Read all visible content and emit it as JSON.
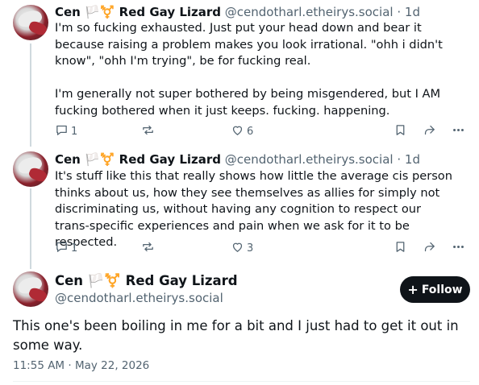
{
  "posts": [
    {
      "author_name": "Cen 🏳️⚧️ Red Gay Lizard",
      "handle": "@cendotharl.etheirys.social",
      "time": "· 1d",
      "paragraphs": [
        "I'm so fucking exhausted. Just put your head down and bear it because raising a problem makes you look irrational. \"ohh i didn't know\", \"ohh I'm trying\", be for fucking real.",
        "I'm generally not super bothered by being misgendered, but I AM fucking bothered when it just keeps. fucking. happening."
      ],
      "reply_count": "1",
      "favorite_count": "6"
    },
    {
      "author_name": "Cen 🏳️⚧️ Red Gay Lizard",
      "handle": "@cendotharl.etheirys.social",
      "time": "· 1d",
      "paragraphs": [
        "It's stuff like this that really shows how little the average cis person thinks about us, how they see themselves as allies for simply not discriminating us, without having any cognition to respect our trans-specific experiences and pain when we ask for it to be respected."
      ],
      "reply_count": "1",
      "favorite_count": "3"
    }
  ],
  "main_post": {
    "author_name": "Cen 🏳️⚧️ Red Gay Lizard",
    "handle": "@cendotharl.etheirys.social",
    "follow_label": "Follow",
    "text": "This one's been boiling in me for a bit and I just had to get it out in some way.",
    "timestamp": "11:55 AM · May 22, 2026"
  },
  "icons": [
    "reply-icon",
    "boost-icon",
    "favorite-icon",
    "bookmark-icon",
    "share-icon",
    "more-icon",
    "plus-icon"
  ],
  "colors": {
    "text": "#0f1419",
    "muted": "#536471",
    "button": "#0f1419"
  }
}
